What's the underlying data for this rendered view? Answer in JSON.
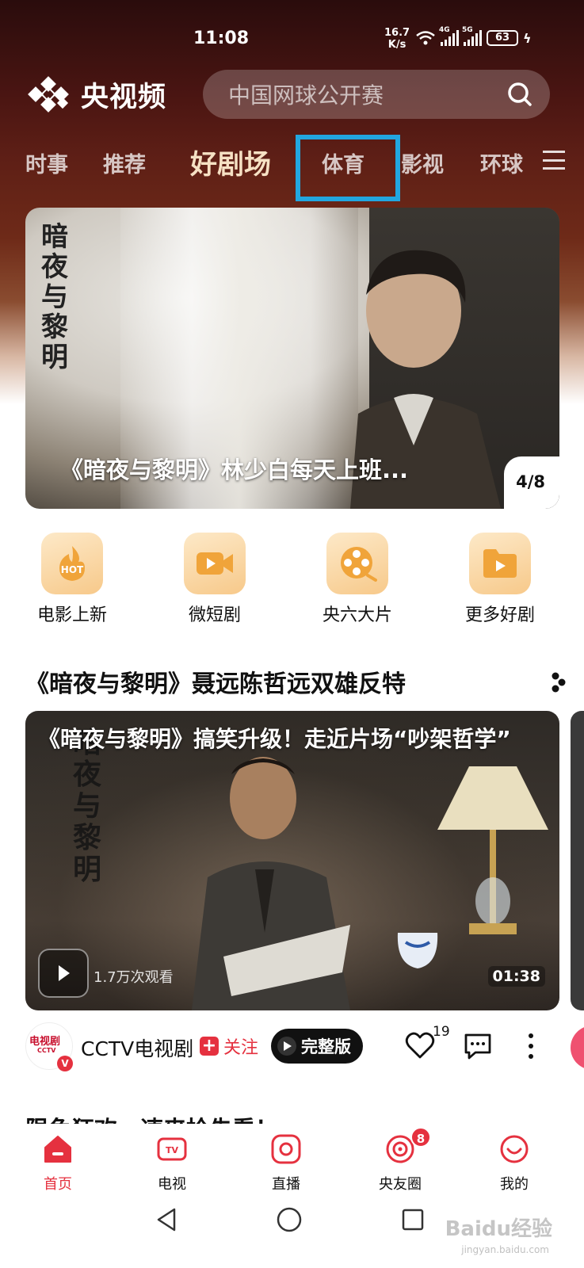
{
  "status_bar": {
    "time": "11:08",
    "net_speed_value": "16.7",
    "net_speed_unit": "K/s",
    "battery": "63",
    "sim1": "4G",
    "sim2": "5G"
  },
  "header": {
    "app_name": "央视频",
    "search_placeholder": "中国网球公开赛"
  },
  "tabs": [
    {
      "label": "时事"
    },
    {
      "label": "推荐"
    },
    {
      "label": "好剧场",
      "active": true
    },
    {
      "label": "体育",
      "highlighted": true
    },
    {
      "label": "影视"
    },
    {
      "label": "环球"
    }
  ],
  "banner": {
    "calligraphy": "暗夜与黎明",
    "title": "《暗夜与黎明》林少白每天上班...",
    "counter": "4/8"
  },
  "quick_links": [
    {
      "label": "电影上新",
      "icon": "hot-icon",
      "icon_text": "HOT"
    },
    {
      "label": "微短剧",
      "icon": "video-camera-icon"
    },
    {
      "label": "央六大片",
      "icon": "film-reel-icon"
    },
    {
      "label": "更多好剧",
      "icon": "folder-play-icon"
    }
  ],
  "section": {
    "title": "《暗夜与黎明》聂远陈哲远双雄反特"
  },
  "video": {
    "calligraphy": "暗夜与黎明",
    "title": "《暗夜与黎明》搞笑升级！走近片场“吵架哲学”",
    "views": "1.7万次观看",
    "duration": "01:38"
  },
  "author": {
    "name": "CCTV电视剧",
    "avatar_text": "电视剧",
    "avatar_sub": "CCTV",
    "follow_label": "关注",
    "full_label": "完整版",
    "likes": "19"
  },
  "section2": {
    "title": "限免狂欢，速来抢先看！"
  },
  "bottom_nav": [
    {
      "label": "首页",
      "active": true
    },
    {
      "label": "电视"
    },
    {
      "label": "直播"
    },
    {
      "label": "央友圈",
      "badge": "8"
    },
    {
      "label": "我的"
    }
  ],
  "watermark": {
    "text": "Baidu经验",
    "sub": "jingyan.baidu.com"
  },
  "colors": {
    "accent": "#e5313f",
    "highlight_box": "#22a7e0",
    "active_tab": "#f6e1c4",
    "quick_icon": "#f7c98a"
  }
}
